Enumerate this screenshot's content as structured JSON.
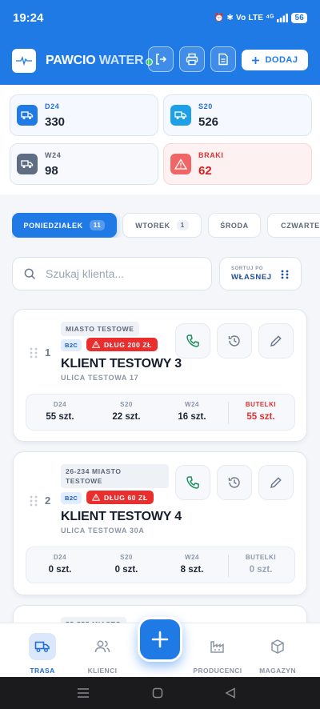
{
  "status_bar": {
    "time": "19:24",
    "icons_text": "⏰ ✱ Vo LTE ⁴ᴳ",
    "battery": "56"
  },
  "header": {
    "brand_main": "PAWCIO ",
    "brand_accent": "WATER",
    "add_label": "DODAJ",
    "icons": [
      "logout-icon",
      "printer-icon",
      "document-icon",
      "plus-icon"
    ]
  },
  "stats": [
    {
      "label": "D24",
      "value": "330",
      "color": "#1f6fd8"
    },
    {
      "label": "S20",
      "value": "526",
      "color": "#1f6fd8"
    },
    {
      "label": "W24",
      "value": "98",
      "color": "#5c6778"
    },
    {
      "label": "BRAKI",
      "value": "62",
      "color": "#e03131"
    }
  ],
  "tabs": [
    {
      "label": "PONIEDZIAŁEK",
      "count": "11",
      "active": true
    },
    {
      "label": "WTOREK",
      "count": "1"
    },
    {
      "label": "ŚRODA",
      "count": ""
    },
    {
      "label": "CZWARTEK",
      "count": ""
    }
  ],
  "search": {
    "placeholder": "Szukaj klienta..."
  },
  "sort": {
    "small": "SORTUJ PO",
    "big": "WŁASNEJ"
  },
  "clients": [
    {
      "number": "1",
      "city": "MIASTO TESTOWE",
      "type": "B2C",
      "debt": "DŁUG 200 ZŁ",
      "name": "KLIENT TESTOWY 3",
      "street": "ULICA TESTOWA 17",
      "quantities": [
        {
          "label": "D24",
          "value": "55 szt."
        },
        {
          "label": "S20",
          "value": "22 szt."
        },
        {
          "label": "W24",
          "value": "16 szt."
        },
        {
          "label": "BUTELKI",
          "value": "55 szt."
        }
      ]
    },
    {
      "number": "2",
      "city_line1": "26-234 MIASTO",
      "city_line2": "TESTOWE",
      "type": "B2C",
      "debt": "DŁUG 60 ZŁ",
      "name": "KLIENT TESTOWY 4",
      "street": "ULICA TESTOWA 30A",
      "quantities": [
        {
          "label": "D24",
          "value": "0 szt."
        },
        {
          "label": "S20",
          "value": "0 szt."
        },
        {
          "label": "W24",
          "value": "8 szt."
        },
        {
          "label": "BUTELKI",
          "value": "0 szt."
        }
      ]
    },
    {
      "city": "55-555 MIASTO"
    }
  ],
  "bottom_nav": [
    {
      "label": "TRASA",
      "active": true
    },
    {
      "label": "KLIENCI"
    },
    {
      "label": "PRODUCENCI"
    },
    {
      "label": "MAGAZYN"
    }
  ],
  "colors": {
    "primary": "#1f7ae6",
    "danger": "#ea2d2d",
    "background": "#f4f6fa"
  }
}
